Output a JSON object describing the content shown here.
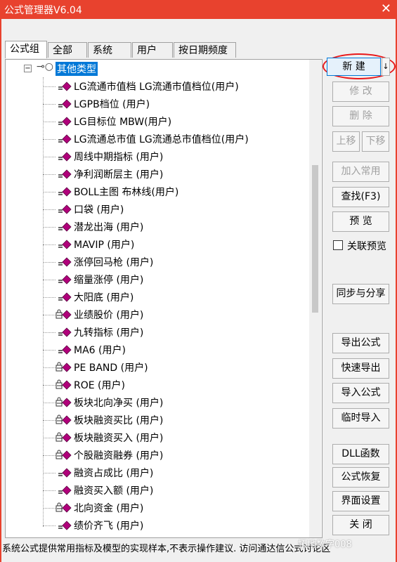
{
  "window": {
    "title": "公式管理器V6.04",
    "close_glyph": "✕"
  },
  "tabs": [
    {
      "label": "公式组"
    },
    {
      "label": "全部"
    },
    {
      "label": "系统"
    },
    {
      "label": "用户"
    },
    {
      "label": "按日期频度"
    }
  ],
  "tree": {
    "root_label": "其他类型",
    "expander": "−",
    "items": [
      {
        "label": "LG流通市值档  LG流通市值档位(用户)",
        "icon": "formula-icon"
      },
      {
        "label": "LGPB档位  (用户)",
        "icon": "formula-icon"
      },
      {
        "label": "LG目标位  MBW(用户)",
        "icon": "formula-icon"
      },
      {
        "label": "LG流通总市值  LG流通总市值档位(用户)",
        "icon": "formula-icon"
      },
      {
        "label": "周线中期指标  (用户)",
        "icon": "formula-icon"
      },
      {
        "label": "净利润断层主  (用户)",
        "icon": "formula-icon"
      },
      {
        "label": "BOLL主图  布林线(用户)",
        "icon": "formula-icon"
      },
      {
        "label": "口袋  (用户)",
        "icon": "formula-icon"
      },
      {
        "label": "潜龙出海  (用户)",
        "icon": "formula-icon"
      },
      {
        "label": "MAVIP  (用户)",
        "icon": "formula-icon"
      },
      {
        "label": "涨停回马枪  (用户)",
        "icon": "formula-icon"
      },
      {
        "label": "缩量涨停  (用户)",
        "icon": "formula-icon"
      },
      {
        "label": "大阳底  (用户)",
        "icon": "formula-icon"
      },
      {
        "label": "业绩股价  (用户)",
        "icon": "locked-formula-icon"
      },
      {
        "label": "九转指标  (用户)",
        "icon": "formula-icon"
      },
      {
        "label": "MA6  (用户)",
        "icon": "formula-icon"
      },
      {
        "label": "PE BAND  (用户)",
        "icon": "locked-formula-icon"
      },
      {
        "label": "ROE  (用户)",
        "icon": "locked-formula-icon"
      },
      {
        "label": "板块北向净买  (用户)",
        "icon": "locked-formula-icon"
      },
      {
        "label": "板块融资买比  (用户)",
        "icon": "locked-formula-icon"
      },
      {
        "label": "板块融资买入  (用户)",
        "icon": "locked-formula-icon"
      },
      {
        "label": "个股融资融券  (用户)",
        "icon": "locked-formula-icon"
      },
      {
        "label": "融资占成比  (用户)",
        "icon": "formula-icon"
      },
      {
        "label": "融资买入额  (用户)",
        "icon": "formula-icon"
      },
      {
        "label": "北向资金  (用户)",
        "icon": "locked-formula-icon"
      },
      {
        "label": "绩价齐飞  (用户)",
        "icon": "formula-icon"
      }
    ]
  },
  "buttons": {
    "new": "新 建",
    "new_arrow": "↓",
    "modify": "修 改",
    "delete": "删 除",
    "move_up": "上移",
    "move_down": "下移",
    "add_common": "加入常用",
    "find": "查找(F3)",
    "preview": "预 览",
    "link_preview": "关联预览",
    "sync_share": "同步与分享",
    "export_formula": "导出公式",
    "quick_export": "快速导出",
    "import_formula": "导入公式",
    "temp_import": "临时导入",
    "dll_func": "DLL函数",
    "restore_formula": "公式恢复",
    "ui_settings": "界面设置",
    "close": "关 闭"
  },
  "status": {
    "text": "系统公式提供常用指标及模型的实现样本,不表示操作建议.  访问通达信公式讨论区",
    "watermark": "拓地数字008"
  },
  "colors": {
    "title_bar": "#e8422e",
    "selection": "#0078d7",
    "formula_icon": "#b0007a",
    "annotation_circle": "#e8181a"
  }
}
